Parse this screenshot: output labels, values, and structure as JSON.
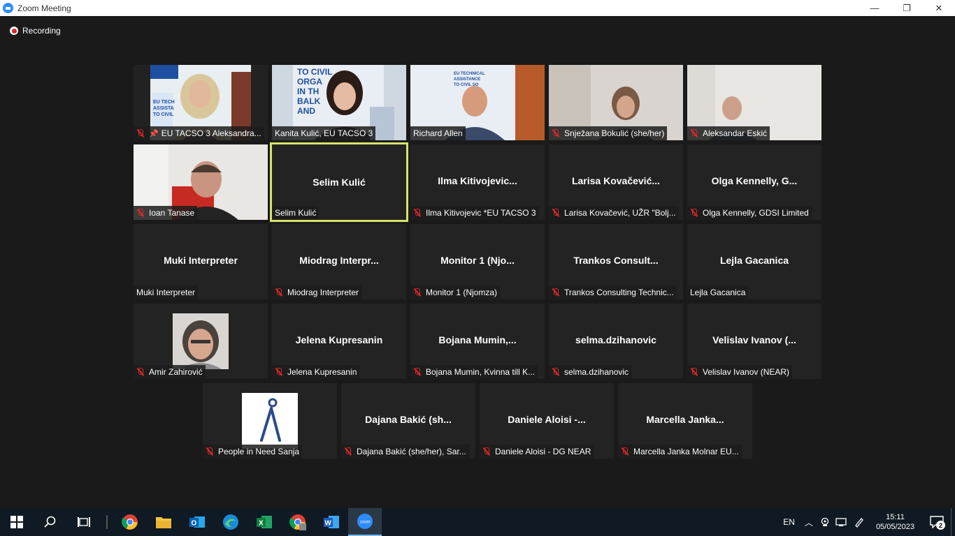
{
  "window": {
    "title": "Zoom Meeting",
    "min": "—",
    "restore": "❐",
    "close": "✕"
  },
  "recording": {
    "label": "Recording"
  },
  "tiles": [
    {
      "label": "EU TACSO 3 Aleksandra...",
      "muted": true,
      "pinned": true
    },
    {
      "label": "Kanita Kulić, EU TACSO 3",
      "muted": false
    },
    {
      "label": "Richard Allen",
      "muted": false
    },
    {
      "label": "Snježana Bokulić (she/her)",
      "muted": true
    },
    {
      "label": "Aleksandar Eskić",
      "muted": true
    },
    {
      "label": "Ioan Tanase",
      "muted": true
    },
    {
      "name": "Selim Kulić",
      "label": "Selim Kulić",
      "muted": false
    },
    {
      "name": "Ilma  Kitivojevic...",
      "label": "Ilma Kitivojevic *EU TACSO 3",
      "muted": true
    },
    {
      "name": "Larisa  Kovačević...",
      "label": "Larisa Kovačević, UŽR \"Bolj...",
      "muted": true
    },
    {
      "name": "Olga  Kennelly,  G...",
      "label": "Olga Kennelly, GDSI Limited",
      "muted": true
    },
    {
      "name": "Muki Interpreter",
      "label": "Muki Interpreter",
      "muted": false
    },
    {
      "name": "Miodrag  Interpr...",
      "label": "Miodrag Interpreter",
      "muted": true
    },
    {
      "name": "Monitor  1  (Njo...",
      "label": "Monitor 1 (Njomza)",
      "muted": true
    },
    {
      "name": "Trankos  Consult...",
      "label": "Trankos Consulting Technic...",
      "muted": true
    },
    {
      "name": "Lejla Gacanica",
      "label": "Lejla Gacanica",
      "muted": false
    },
    {
      "label": "Amir Zahirović",
      "muted": true
    },
    {
      "name": "Jelena Kupresanin",
      "label": "Jelena Kupresanin",
      "muted": true
    },
    {
      "name": "Bojana  Mumin,...",
      "label": "Bojana Mumin, Kvinna till K...",
      "muted": true
    },
    {
      "name": "selma.dzihanovic",
      "label": "selma.dzihanovic",
      "muted": true
    },
    {
      "name": "Velislav  Ivanov  (...",
      "label": "Velislav Ivanov (NEAR)",
      "muted": true
    },
    {
      "label": "People in Need Sanja",
      "muted": true
    },
    {
      "name": "Dajana  Bakić  (sh...",
      "label": "Dajana Bakić (she/her), Sar...",
      "muted": true
    },
    {
      "name": "Daniele  Aloisi  -...",
      "label": "Daniele Aloisi - DG NEAR",
      "muted": true
    },
    {
      "name": "Marcella  Janka...",
      "label": "Marcella Janka Molnar EU...",
      "muted": true
    }
  ],
  "taskbar": {
    "lang": "EN",
    "time": "15:11",
    "date": "05/05/2023",
    "notifications": "2"
  },
  "colors": {
    "active_speaker": "#d6e36a",
    "muted": "#e02828",
    "zoom_blue": "#2d8cff"
  }
}
